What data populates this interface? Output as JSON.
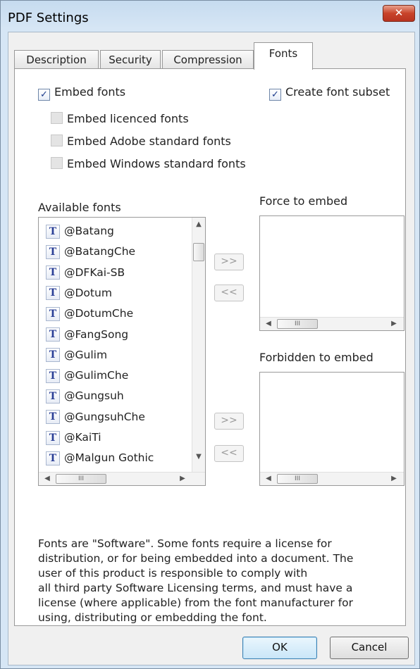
{
  "window": {
    "title": "PDF Settings",
    "close_glyph": "✕"
  },
  "tabs": [
    {
      "label": "Description"
    },
    {
      "label": "Security"
    },
    {
      "label": "Compression"
    },
    {
      "label": "Fonts",
      "active": true
    }
  ],
  "options": {
    "embed_fonts": {
      "label": "Embed fonts",
      "checked": true
    },
    "create_subset": {
      "label": "Create font subset",
      "checked": true
    },
    "embed_licenced": {
      "label": "Embed licenced fonts",
      "checked": false,
      "disabled": true
    },
    "embed_adobe": {
      "label": "Embed Adobe standard fonts",
      "checked": false,
      "disabled": true
    },
    "embed_windows": {
      "label": "Embed Windows standard fonts",
      "checked": false,
      "disabled": true
    }
  },
  "available": {
    "label": "Available fonts",
    "icon_glyph": "T",
    "items": [
      "@Batang",
      "@BatangChe",
      "@DFKai-SB",
      "@Dotum",
      "@DotumChe",
      "@FangSong",
      "@Gulim",
      "@GulimChe",
      "@Gungsuh",
      "@GungsuhChe",
      "@KaiTi",
      "@Malgun Gothic"
    ]
  },
  "force": {
    "label": "Force to embed",
    "add_label": ">>",
    "remove_label": "<<"
  },
  "forbidden": {
    "label": "Forbidden to embed",
    "add_label": ">>",
    "remove_label": "<<"
  },
  "scroll": {
    "up": "▲",
    "down": "▼",
    "left": "◀",
    "right": "▶",
    "grip": "III"
  },
  "note": {
    "line1": "Fonts are \"Software\". Some fonts require a license for",
    "line2": "distribution, or for being embedded into a document. The",
    "line3": "user of this product is responsible to comply with",
    "line4": "all third party Software Licensing terms, and must have a",
    "line5": "license (where applicable) from the font manufacturer for",
    "line6": "using, distributing or embedding the font."
  },
  "buttons": {
    "ok": "OK",
    "cancel": "Cancel"
  }
}
